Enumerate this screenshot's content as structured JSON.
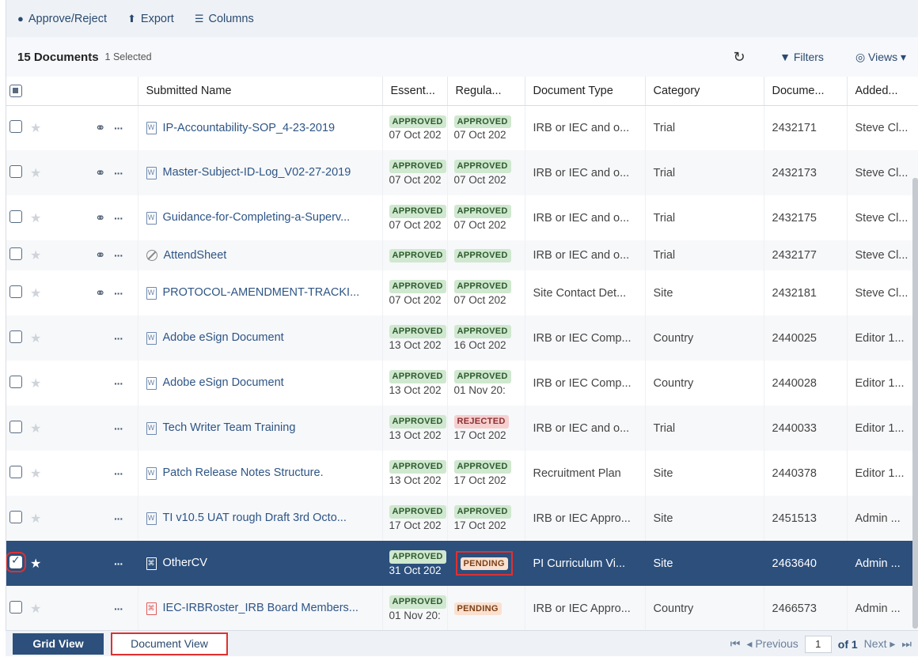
{
  "toolbar": {
    "approve_label": "Approve/Reject",
    "export_label": "Export",
    "columns_label": "Columns"
  },
  "summary": {
    "count_label": "15 Documents",
    "selected_label": "1 Selected",
    "filters_label": "Filters",
    "views_label": "Views"
  },
  "columns": {
    "submitted_name": "Submitted Name",
    "essential": "Essent...",
    "regulatory": "Regula...",
    "document_type": "Document Type",
    "category": "Category",
    "document_id": "Docume...",
    "added_by": "Added..."
  },
  "rows": [
    {
      "name": "IP-Accountability-SOP_4-23-2019",
      "file_icon": "word",
      "linked": true,
      "ess_status": "APPROVED",
      "ess_date": "07 Oct 202",
      "reg_status": "APPROVED",
      "reg_date": "07 Oct 202",
      "doc_type": "IRB or IEC and o...",
      "category": "Trial",
      "doc_id": "2432171",
      "added_by": "Steve Cl..."
    },
    {
      "name": "Master-Subject-ID-Log_V02-27-2019",
      "file_icon": "word",
      "linked": true,
      "ess_status": "APPROVED",
      "ess_date": "07 Oct 202",
      "reg_status": "APPROVED",
      "reg_date": "07 Oct 202",
      "doc_type": "IRB or IEC and o...",
      "category": "Trial",
      "doc_id": "2432173",
      "added_by": "Steve Cl..."
    },
    {
      "name": "Guidance-for-Completing-a-Superv...",
      "file_icon": "word",
      "linked": true,
      "ess_status": "APPROVED",
      "ess_date": "07 Oct 202",
      "reg_status": "APPROVED",
      "reg_date": "07 Oct 202",
      "doc_type": "IRB or IEC and o...",
      "category": "Trial",
      "doc_id": "2432175",
      "added_by": "Steve Cl..."
    },
    {
      "name": "AttendSheet",
      "file_icon": "none",
      "linked": true,
      "ess_status": "APPROVED",
      "ess_date": "",
      "reg_status": "APPROVED",
      "reg_date": "",
      "doc_type": "IRB or IEC and o...",
      "category": "Trial",
      "doc_id": "2432177",
      "added_by": "Steve Cl..."
    },
    {
      "name": "PROTOCOL-AMENDMENT-TRACKI...",
      "file_icon": "word",
      "linked": true,
      "ess_status": "APPROVED",
      "ess_date": "07 Oct 202",
      "reg_status": "APPROVED",
      "reg_date": "07 Oct 202",
      "doc_type": "Site Contact Det...",
      "category": "Site",
      "doc_id": "2432181",
      "added_by": "Steve Cl..."
    },
    {
      "name": "Adobe eSign Document",
      "file_icon": "word",
      "linked": false,
      "ess_status": "APPROVED",
      "ess_date": "13 Oct 202",
      "reg_status": "APPROVED",
      "reg_date": "16 Oct 202",
      "doc_type": "IRB or IEC Comp...",
      "category": "Country",
      "doc_id": "2440025",
      "added_by": "Editor 1..."
    },
    {
      "name": "Adobe eSign Document",
      "file_icon": "word",
      "linked": false,
      "ess_status": "APPROVED",
      "ess_date": "13 Oct 202",
      "reg_status": "APPROVED",
      "reg_date": "01 Nov 20:",
      "doc_type": "IRB or IEC Comp...",
      "category": "Country",
      "doc_id": "2440028",
      "added_by": "Editor 1..."
    },
    {
      "name": "Tech Writer Team Training",
      "file_icon": "word",
      "linked": false,
      "ess_status": "APPROVED",
      "ess_date": "13 Oct 202",
      "reg_status": "REJECTED",
      "reg_date": "17 Oct 202",
      "doc_type": "IRB or IEC and o...",
      "category": "Trial",
      "doc_id": "2440033",
      "added_by": "Editor 1..."
    },
    {
      "name": "Patch Release Notes Structure.",
      "file_icon": "word",
      "linked": false,
      "ess_status": "APPROVED",
      "ess_date": "13 Oct 202",
      "reg_status": "APPROVED",
      "reg_date": "17 Oct 202",
      "doc_type": "Recruitment Plan",
      "category": "Site",
      "doc_id": "2440378",
      "added_by": "Editor 1..."
    },
    {
      "name": "TI v10.5 UAT rough Draft 3rd Octo...",
      "file_icon": "word",
      "linked": false,
      "ess_status": "APPROVED",
      "ess_date": "17 Oct 202",
      "reg_status": "APPROVED",
      "reg_date": "17 Oct 202",
      "doc_type": "IRB or IEC Appro...",
      "category": "Site",
      "doc_id": "2451513",
      "added_by": "Admin ..."
    },
    {
      "name": "OtherCV",
      "file_icon": "pdf",
      "linked": false,
      "ess_status": "APPROVED",
      "ess_date": "31 Oct 202",
      "reg_status": "PENDING",
      "reg_date": "",
      "doc_type": "PI Curriculum Vi...",
      "category": "Site",
      "doc_id": "2463640",
      "added_by": "Admin ...",
      "selected": true
    },
    {
      "name": "IEC-IRBRoster_IRB Board Members...",
      "file_icon": "pdf",
      "linked": false,
      "ess_status": "APPROVED",
      "ess_date": "01 Nov 20:",
      "reg_status": "PENDING",
      "reg_date": "",
      "doc_type": "IRB or IEC Appro...",
      "category": "Country",
      "doc_id": "2466573",
      "added_by": "Admin ..."
    }
  ],
  "footer": {
    "grid_view_label": "Grid View",
    "document_view_label": "Document View",
    "previous_label": "Previous",
    "page_value": "1",
    "of_label": "of 1",
    "next_label": "Next"
  },
  "colors": {
    "selected_row": "#2c4f7c",
    "approved_badge": "#cfe8cf",
    "rejected_badge": "#f6cfcf",
    "pending_badge": "#fbe0cf",
    "highlight": "#e03030"
  }
}
